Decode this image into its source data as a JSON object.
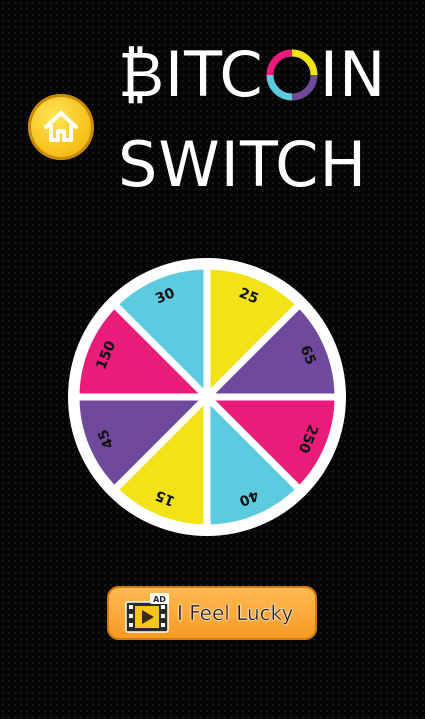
{
  "title": {
    "line1_prefix": "₿ITC",
    "line1_suffix": "IN",
    "line2": "SWITCH"
  },
  "wheel": {
    "segments": [
      {
        "label": "25",
        "color": "#f2e318"
      },
      {
        "label": "65",
        "color": "#6f4a9c"
      },
      {
        "label": "250",
        "color": "#ea1c7a"
      },
      {
        "label": "40",
        "color": "#5ccbe0"
      },
      {
        "label": "15",
        "color": "#f2e318"
      },
      {
        "label": "45",
        "color": "#6f4a9c"
      },
      {
        "label": "150",
        "color": "#ea1c7a"
      },
      {
        "label": "30",
        "color": "#5ccbe0"
      }
    ],
    "rim_color": "#ffffff"
  },
  "lucky_button": {
    "badge": "AD",
    "label": "I Feel Lucky"
  },
  "icons": {
    "home": "home-icon",
    "video_ad": "video-ad-icon"
  },
  "colors": {
    "coin_ring": [
      "#f2e318",
      "#ea1c7a",
      "#5ccbe0",
      "#6f4a9c"
    ],
    "button_orange": "#f79a22",
    "home_yellow": "#f7c51e"
  }
}
